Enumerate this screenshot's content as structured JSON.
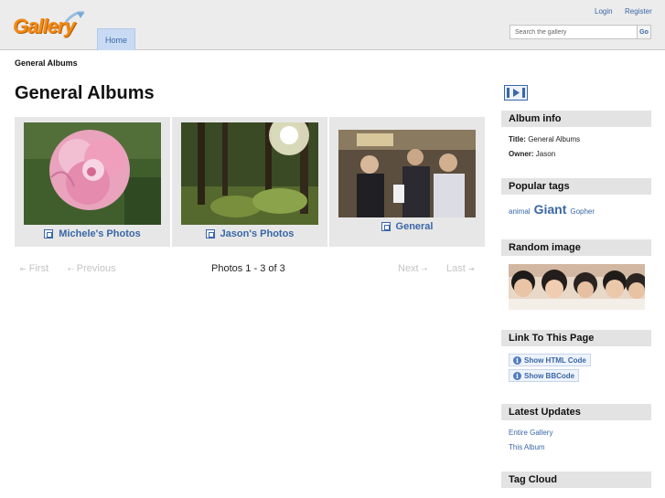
{
  "header": {
    "logo_text": "Gallery",
    "home_tab": "Home",
    "login": "Login",
    "register": "Register",
    "search_placeholder": "Search the gallery",
    "go_button": "Go"
  },
  "breadcrumb": "General Albums",
  "page_title": "General Albums",
  "albums": [
    {
      "title": "Michele's Photos"
    },
    {
      "title": "Jason's Photos"
    },
    {
      "title": "General"
    }
  ],
  "pager": {
    "first": "First",
    "previous": "Previous",
    "status": "Photos 1 - 3 of 3",
    "next": "Next",
    "last": "Last"
  },
  "sidebar": {
    "album_info": {
      "heading": "Album info",
      "title_label": "Title:",
      "title_value": "General Albums",
      "owner_label": "Owner:",
      "owner_value": "Jason"
    },
    "popular_tags": {
      "heading": "Popular tags",
      "tags": [
        "animal",
        "Giant",
        "Gopher"
      ]
    },
    "random_image": {
      "heading": "Random image"
    },
    "link_to_page": {
      "heading": "Link To This Page",
      "html_button": "Show HTML Code",
      "bbcode_button": "Show BBCode"
    },
    "latest_updates": {
      "heading": "Latest Updates",
      "links": [
        "Entire Gallery",
        "This Album"
      ]
    },
    "tag_cloud": {
      "heading": "Tag Cloud"
    }
  },
  "colors": {
    "link": "#3a67a7",
    "header_bg": "#ececec",
    "tab_bg": "#c9dbf4",
    "panel_bg": "#e7e7e7",
    "logo_orange": "#f08a16"
  }
}
